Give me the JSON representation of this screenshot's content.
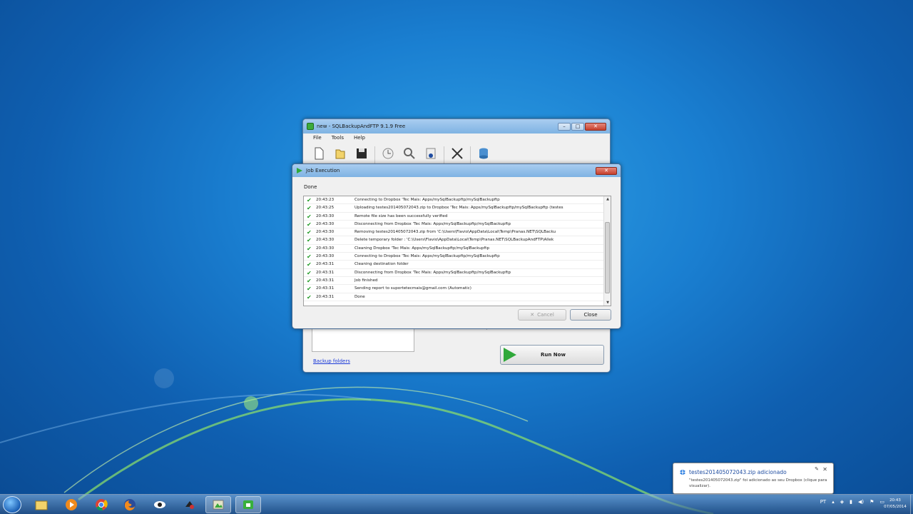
{
  "main_window": {
    "title": "new - SQLBackupAndFTP 9.1.9 Free",
    "menu": [
      "File",
      "Tools",
      "Help"
    ],
    "toolbar": [
      {
        "icon": "new-file-icon",
        "label": ""
      },
      {
        "icon": "open-icon",
        "label": ""
      },
      {
        "icon": "save-icon",
        "label": ""
      },
      {
        "icon": "schedule-icon",
        "label": ""
      },
      {
        "icon": "log-icon",
        "label": ""
      },
      {
        "icon": "backups-icon",
        "label": ""
      },
      {
        "icon": "settings-tools-icon",
        "label": ""
      },
      {
        "icon": "database-icon",
        "label": ""
      }
    ],
    "backup_folders_link": "Backup folders",
    "run_now_label": "Run Now"
  },
  "job_dialog": {
    "title": "Job Execution",
    "status": "Done",
    "log": [
      {
        "time": "20:43:23",
        "message": "Connecting to Dropbox 'Tec Mais: Apps/mySqlBackupftp/mySqlBackupftp"
      },
      {
        "time": "20:43:25",
        "message": "Uploading testes201405072043.zip to Dropbox 'Tec Mais: Apps/mySqlBackupftp/mySqlBackupftp (testes"
      },
      {
        "time": "20:43:30",
        "message": "Remote file size has been successfully verified"
      },
      {
        "time": "20:43:30",
        "message": "Disconnecting from Dropbox 'Tec Mais: Apps/mySqlBackupftp/mySqlBackupftp"
      },
      {
        "time": "20:43:30",
        "message": "Removing testes201405072043.zip from 'C:\\Users\\Flavio\\AppData\\Local\\Temp\\Pranas.NET\\SQLBacku"
      },
      {
        "time": "20:43:30",
        "message": "Delete temporary folder : 'C:\\Users\\Flavio\\AppData\\Local\\Temp\\Pranas.NET\\SQLBackupAndFTP\\Allek"
      },
      {
        "time": "20:43:30",
        "message": "Cleaning Dropbox 'Tec Mais: Apps/mySqlBackupftp/mySqlBackupftp"
      },
      {
        "time": "20:43:30",
        "message": "Connecting to Dropbox 'Tec Mais: Apps/mySqlBackupftp/mySqlBackupftp"
      },
      {
        "time": "20:43:31",
        "message": "Cleaning destination folder"
      },
      {
        "time": "20:43:31",
        "message": "Disconnecting from Dropbox 'Tec Mais: Apps/mySqlBackupftp/mySqlBackupftp"
      },
      {
        "time": "20:43:31",
        "message": "Job finished"
      },
      {
        "time": "20:43:31",
        "message": "Sending report to suportetecmais@gmail.com (Automatic)"
      },
      {
        "time": "20:43:31",
        "message": "Done"
      }
    ],
    "cancel_label": "Cancel",
    "close_label": "Close"
  },
  "notification": {
    "title": "testes201405072043.zip adicionado",
    "body": "\"testes201405072043.zip\" foi adicionado ao seu Dropbox (clique para visualizar)."
  },
  "taskbar": {
    "apps": [
      "explorer-icon",
      "media-player-icon",
      "chrome-icon",
      "firefox-icon",
      "app-eye-icon",
      "app-tool-icon",
      "sqlbackup-icon",
      "sqlbackup-active-icon"
    ],
    "tray_language": "PT",
    "clock_time": "20:43",
    "clock_date": "07/05/2014"
  },
  "colors": {
    "desktop": "#1a7fd1",
    "titlebar": "#a9cdf0",
    "check": "#1f9a24",
    "link": "#1b3ad8",
    "run_arrow": "#2fa83a"
  }
}
